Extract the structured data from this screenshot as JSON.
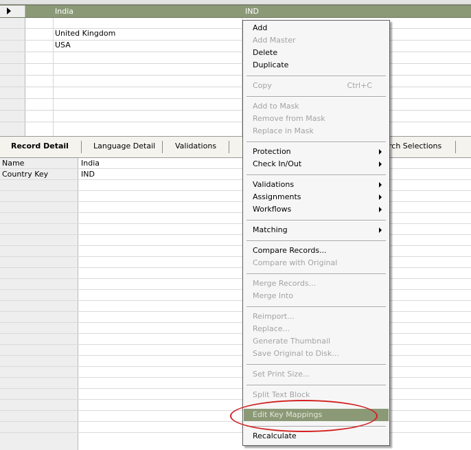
{
  "grid": {
    "rows": [
      {
        "name": "India",
        "country": "IND",
        "selected": true
      },
      {
        "name": "United Kingdom",
        "country": "",
        "selected": false
      },
      {
        "name": "USA",
        "country": "",
        "selected": false
      }
    ]
  },
  "tabs": [
    {
      "label": "Record Detail",
      "active": true
    },
    {
      "label": "Language Detail",
      "active": false
    },
    {
      "label": "Validations",
      "active": false
    },
    {
      "label": "rch Selections",
      "active": false
    }
  ],
  "record_detail": {
    "fields": [
      {
        "label": "Name",
        "value": "India"
      },
      {
        "label": "Country Key",
        "value": "IND"
      }
    ]
  },
  "context_menu": {
    "items": {
      "add": "Add",
      "add_master": "Add Master",
      "delete": "Delete",
      "duplicate": "Duplicate",
      "copy": "Copy",
      "copy_shortcut": "Ctrl+C",
      "add_to_mask": "Add to Mask",
      "remove_from_mask": "Remove from Mask",
      "replace_in_mask": "Replace in Mask",
      "protection": "Protection",
      "check_in_out": "Check In/Out",
      "validations": "Validations",
      "assignments": "Assignments",
      "workflows": "Workflows",
      "matching": "Matching",
      "compare_records": "Compare Records...",
      "compare_with_original": "Compare with Original",
      "merge_records": "Merge Records...",
      "merge_into": "Merge Into",
      "reimport": "Reimport...",
      "replace": "Replace...",
      "generate_thumbnail": "Generate Thumbnail",
      "save_original": "Save Original to Disk...",
      "set_print_size": "Set Print Size...",
      "split_text_block": "Split Text Block",
      "edit_key_mappings": "Edit Key Mappings",
      "recalculate": "Recalculate"
    }
  },
  "colors": {
    "selection": "#8c9977",
    "annotation": "#d22020"
  }
}
